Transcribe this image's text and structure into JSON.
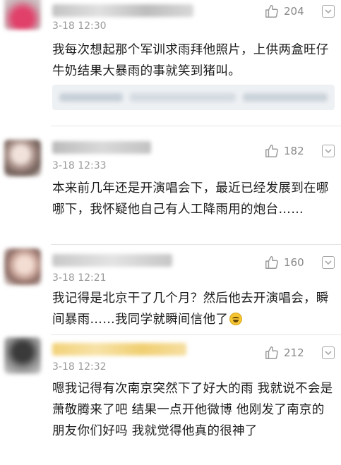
{
  "comments": [
    {
      "time": "3-18 12:30",
      "likes": "204",
      "text": "我每次想起那个军训求雨拜他照片，上供两盒旺仔牛奶结果大暴雨的事就笑到猪叫。"
    },
    {
      "time": "3-18 12:33",
      "likes": "182",
      "text": "本来前几年还是开演唱会下，最近已经发展到在哪哪下，我怀疑他自己有人工降雨用的炮台……"
    },
    {
      "time": "3-18 12:21",
      "likes": "160",
      "text": "我记得是北京干了几个月？然后他去开演唱会，瞬间暴雨……我同学就瞬间信他了"
    },
    {
      "time": "3-18 12:32",
      "likes": "212",
      "text": "嗯我记得有次南京突然下了好大的雨 我就说不会是萧敬腾来了吧 结果一点开他微博 他刚发了南京的朋友你们好吗 我就觉得他真的很神了"
    }
  ],
  "icons": {
    "like": "thumbs-up-icon",
    "more": "chevron-down-icon",
    "emoji": "laughing-emoji-icon"
  },
  "colors": {
    "text": "#1c1c1c",
    "meta": "#9a9a9a",
    "divider": "#e6e6e6"
  }
}
